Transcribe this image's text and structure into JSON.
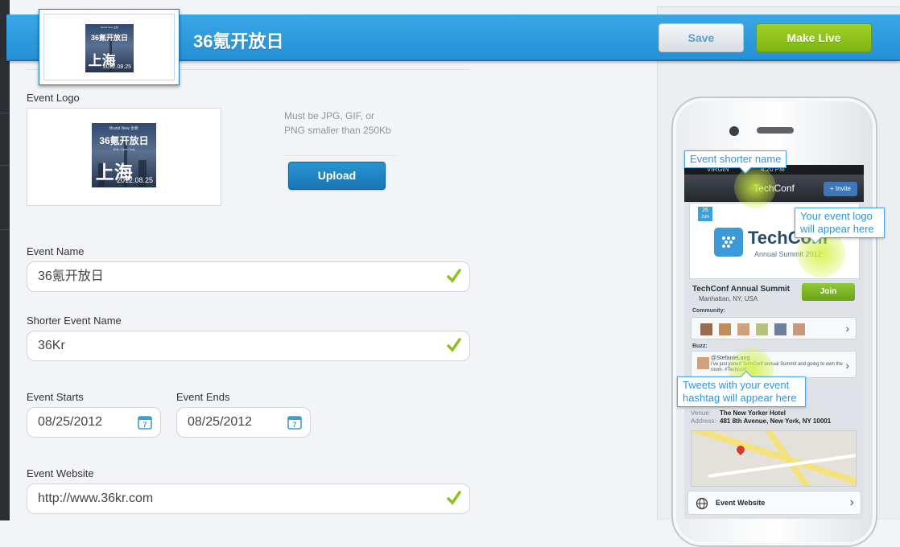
{
  "header": {
    "title": "36氪开放日",
    "save_label": "Save",
    "make_live_label": "Make Live"
  },
  "poster": {
    "top_text": "Brand New 全新",
    "name_cn": "36氪开放日",
    "sub_text": "36Kr Open Day",
    "city": "上海",
    "date": "2012.08.25"
  },
  "form": {
    "logo_label": "Event Logo",
    "logo_help": "Must be JPG, GIF, or PNG smaller than 250Kb",
    "upload_label": "Upload",
    "name_label": "Event Name",
    "name_value": "36氪开放日",
    "short_name_label": "Shorter Event Name",
    "short_name_value": "36Kr",
    "starts_label": "Event Starts",
    "starts_value": "08/25/2012",
    "ends_label": "Event Ends",
    "ends_value": "08/25/2012",
    "calendar_day": "7",
    "website_label": "Event Website",
    "website_value": "http://www.36kr.com"
  },
  "preview": {
    "status_carrier": "VIRGIN",
    "status_time": "4:20 PM",
    "nav_title": "TechConf",
    "invite_label": "+ Invite",
    "date_day": "26",
    "date_month": "JUN",
    "logo_text": "TechConf",
    "logo_sub": "Annual Summit 2012",
    "event_title": "TechConf Annual Summit",
    "event_location": "Manhattan, NY, USA",
    "join_label": "Join",
    "community_label": "Community:",
    "buzz_label": "Buzz:",
    "tweet_user": "@StefanieLang",
    "tweet_text": "I've just joined TechConf annual Summit and going to own the room. #Techconf",
    "venue_label": "Venue:",
    "venue_value": "The New Yorker Hotel",
    "address_label": "Address:",
    "address_value": "481 8th Avenue, New York, NY 10001",
    "website_row": "Event Website"
  },
  "callouts": {
    "short_name": "Event shorter name",
    "logo": "Your event logo will appear here",
    "tweets": "Tweets with your event hashtag will appear here"
  },
  "colors": {
    "header_blue": "#2590d6",
    "live_green": "#8ac21c",
    "check_green": "#8cc21f",
    "link_blue": "#2f95d6"
  }
}
